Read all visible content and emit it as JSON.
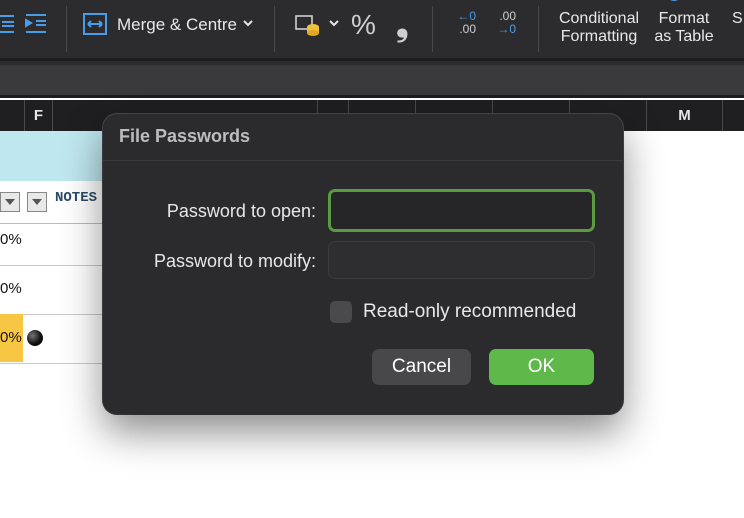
{
  "ribbon": {
    "merge_label": "Merge & Centre",
    "percent_symbol": "%",
    "comma_symbol": "❟",
    "increase_decimal": {
      "top": "←0",
      "bottom": ".00"
    },
    "decrease_decimal": {
      "top": ".00",
      "bottom": "→0"
    },
    "conditional_formatting": {
      "line1": "Conditional",
      "line2": "Formatting"
    },
    "format_as_table": {
      "line1": "Format",
      "line2": "as Table"
    },
    "cell_styles_partial": {
      "line1": "",
      "line2": "S"
    },
    "icons": [
      "indent-decrease-icon",
      "indent-increase-icon",
      "merge-centre-icon",
      "chevron-down-icon",
      "number-format-icon",
      "percent-icon",
      "comma-style-icon",
      "increase-decimal-icon",
      "decrease-decimal-icon"
    ]
  },
  "column_headers": {
    "f": "F",
    "m": "M"
  },
  "sheet": {
    "notes_header": "NOTES",
    "rows": [
      {
        "value": "0%"
      },
      {
        "value": "0%"
      },
      {
        "value": "0%",
        "highlight": "#f7c744"
      }
    ]
  },
  "dialog": {
    "title": "File Passwords",
    "open_label": "Password to open:",
    "open_value": "",
    "modify_label": "Password to modify:",
    "modify_value": "",
    "readonly_label": "Read-only recommended",
    "readonly_checked": false,
    "cancel_label": "Cancel",
    "ok_label": "OK"
  },
  "colors": {
    "ribbon_bg": "#2c2c2e",
    "dialog_bg": "#2b2b2d",
    "focus_ring": "#5b9a43",
    "ok_button": "#5fb84a",
    "cancel_button": "#48484a",
    "sheet_band": "#bfe7ef",
    "accent_blue": "#3a8ee6"
  }
}
